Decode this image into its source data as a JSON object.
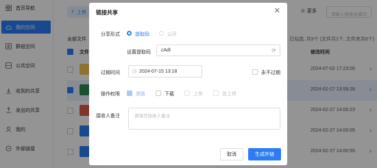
{
  "sidebar": {
    "items": [
      {
        "label": "首页导航",
        "icon": "grid-icon",
        "active": false
      },
      {
        "label": "我的空间",
        "icon": "cloud-icon",
        "active": true
      },
      {
        "label": "群组空间",
        "icon": "group-space-icon",
        "active": false
      },
      {
        "label": "公共空间",
        "icon": "public-space-icon",
        "active": false
      },
      {
        "label": "收到的共享",
        "icon": "received-share-icon",
        "active": false
      },
      {
        "label": "发出的共享",
        "icon": "sent-share-icon",
        "active": false
      },
      {
        "label": "我的",
        "icon": "user-icon",
        "active": false
      },
      {
        "label": "外部链接",
        "icon": "link-icon",
        "active": false
      }
    ]
  },
  "toolbar": {
    "upload_label": "上传",
    "more_label": "更多",
    "search_placeholder": "请输入搜索关键词"
  },
  "file_list": {
    "breadcrumb": "全部文件",
    "stats": "已勾选, 共9个 (文件共1个, 文件夹共8个)",
    "name_header": "文件",
    "time_header": "修改时间",
    "rows": [
      {
        "time": "2024-07-02 17:23:00",
        "type": "folder",
        "checked": false,
        "color": "#f5c451"
      },
      {
        "time": "2024-02-27 13:59:28",
        "type": "file",
        "checked": true,
        "color": "#2e8b57"
      },
      {
        "time": "2024-02-27 14:00:23",
        "type": "file",
        "checked": false,
        "color": "#e05a4b"
      },
      {
        "time": "2024-02-27 14:00:05",
        "type": "file",
        "checked": false,
        "color": "#2b7cf6"
      },
      {
        "time": "2024-02-27 14:00:55",
        "type": "file",
        "checked": false,
        "color": "#2b7cf6"
      }
    ]
  },
  "modal": {
    "title": "链接共享",
    "share_form_label": "分享形式",
    "option_code": "提取码",
    "option_public": "公开",
    "set_code_label": "设置提取码",
    "code_value": "cAdI",
    "expire_label": "过期时间",
    "expire_value": "2024-07-15 13:18",
    "never_expire_label": "永不过期",
    "permission_label": "操作权限",
    "perm_view": "浏览",
    "perm_download": "下载",
    "perm_upload": "上传",
    "perm_upload_only": "仅上传",
    "note_label": "接收人备注",
    "note_placeholder": "请填写接收人备注",
    "cancel_label": "取消",
    "generate_label": "生成外链"
  },
  "colors": {
    "accent": "#2b7cf6",
    "mask": "rgba(0,0,0,0.42)"
  }
}
